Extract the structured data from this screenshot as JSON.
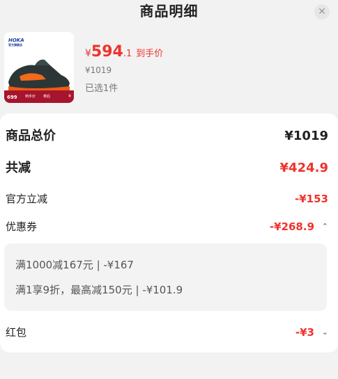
{
  "header": {
    "title": "商品明细",
    "close_glyph": "✕"
  },
  "product": {
    "brand": "HOKA",
    "brand_sub": "官方旗舰店",
    "strip": {
      "price": "699",
      "t2": "到手价",
      "t3": "券后",
      "t4": "¥"
    },
    "hand_price": {
      "yen": "¥",
      "integer": "594",
      "decimal": ".1",
      "label": "到手价"
    },
    "original_price": "¥1019",
    "selected": "已选1件"
  },
  "details": {
    "total": {
      "label": "商品总价",
      "value": "¥1019"
    },
    "reduce": {
      "label": "共减",
      "value": "¥424.9"
    },
    "official": {
      "label": "官方立减",
      "value": "-¥153"
    },
    "coupon": {
      "label": "优惠券",
      "value": "-¥268.9",
      "chevron": "⌃",
      "lines": [
        "满1000减167元 | -¥167",
        "满1享9折，最高减150元 | -¥101.9"
      ]
    },
    "hongbao": {
      "label": "红包",
      "value": "-¥3",
      "chevron": "⌄"
    }
  },
  "colors": {
    "accent": "#f0322c",
    "strip": "#a7142d",
    "brand": "#1c3f9c"
  }
}
